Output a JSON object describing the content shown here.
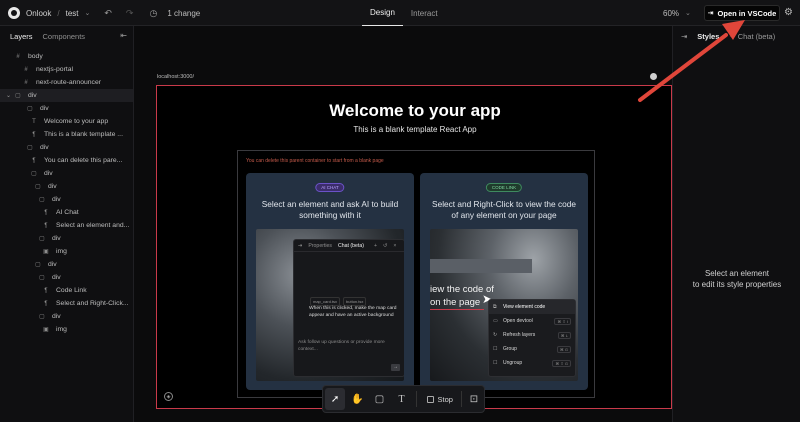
{
  "topbar": {
    "brand": "Onlook",
    "project": "test",
    "change_count": "1 change",
    "modes": [
      "Design",
      "Interact"
    ],
    "zoom": "60%",
    "open_vscode": "Open in VSCode"
  },
  "left_panel": {
    "tabs": [
      "Layers",
      "Components"
    ],
    "layers": [
      {
        "label": "body",
        "glyph": "#"
      },
      {
        "label": "nextjs-portal",
        "glyph": "#"
      },
      {
        "label": "next-route-announcer",
        "glyph": "#"
      },
      {
        "label": "div",
        "glyph": "▢",
        "selected": true
      },
      {
        "label": "div",
        "glyph": "▢"
      },
      {
        "label": "Welcome to your app",
        "glyph": "T"
      },
      {
        "label": "This is a blank template ...",
        "glyph": "¶"
      },
      {
        "label": "div",
        "glyph": "▢"
      },
      {
        "label": "You can delete this pare...",
        "glyph": "¶"
      },
      {
        "label": "div",
        "glyph": "▢"
      },
      {
        "label": "div",
        "glyph": "▢"
      },
      {
        "label": "div",
        "glyph": "▢"
      },
      {
        "label": "AI Chat",
        "glyph": "¶"
      },
      {
        "label": "Select an element and...",
        "glyph": "¶"
      },
      {
        "label": "div",
        "glyph": "▢"
      },
      {
        "label": "img",
        "glyph": "▣"
      },
      {
        "label": "div",
        "glyph": "▢"
      },
      {
        "label": "div",
        "glyph": "▢"
      },
      {
        "label": "Code Link",
        "glyph": "¶"
      },
      {
        "label": "Select and Right-Click...",
        "glyph": "¶"
      },
      {
        "label": "div",
        "glyph": "▢"
      },
      {
        "label": "img",
        "glyph": "▣"
      }
    ]
  },
  "canvas": {
    "url": "localhost:3000/",
    "title": "Welcome to your app",
    "subtitle": "This is a blank template React App",
    "note": "You can delete this parent container to start from a blank page",
    "cards": [
      {
        "badge": "AI CHAT",
        "text": "Select an element and ask AI to build something with it",
        "chat": {
          "tabs": [
            "Properties",
            "Chat (beta)"
          ],
          "files": [
            "map_card.tsx",
            "button.tsx"
          ],
          "message": "When this is clicked, make the map card appear and have an active background",
          "input": "Ask follow up questions or provide more context..."
        }
      },
      {
        "badge": "CODE LINK",
        "text": "Select and Right-Click to view the code of any element on your page",
        "preview_text": [
          "iew the code of",
          "on the page"
        ],
        "menu": [
          {
            "label": "View element code",
            "kbd": ""
          },
          {
            "label": "Open devtool",
            "kbd": "⌘ ⇧ I"
          },
          {
            "label": "Refresh layers",
            "kbd": "⌘ L"
          },
          {
            "label": "Group",
            "kbd": "⌘ G"
          },
          {
            "label": "Ungroup",
            "kbd": "⌘ ⇧ G"
          }
        ]
      }
    ]
  },
  "toolbar": {
    "stop_label": "Stop"
  },
  "right_panel": {
    "tabs": [
      "Styles",
      "Chat (beta)"
    ],
    "empty_line1": "Select an element",
    "empty_line2": "to edit its style properties"
  },
  "colors": {
    "accent_red": "#e0463a",
    "frame_border": "#c93a4a"
  }
}
